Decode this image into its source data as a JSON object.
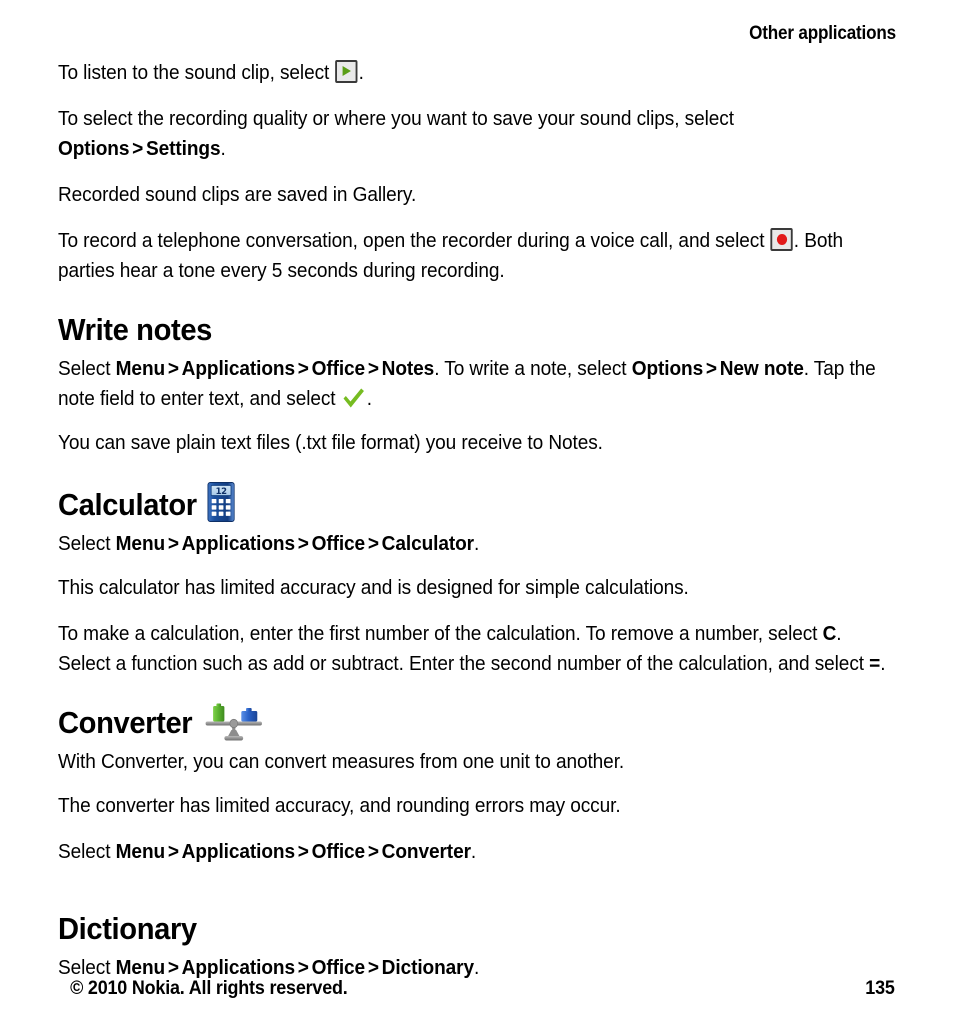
{
  "header": {
    "title": "Other applications"
  },
  "paragraphs": {
    "p1_a": "To listen to the sound clip, select ",
    "p1_b": ".",
    "p2_a": "To select the recording quality or where you want to save your sound clips, select ",
    "p2_options": "Options",
    "p2_gt": ">",
    "p2_settings": "Settings",
    "p2_b": ".",
    "p3": "Recorded sound clips are saved in Gallery.",
    "p4_a": "To record a telephone conversation, open the recorder during a voice call, and select ",
    "p4_b": ". Both parties hear a tone every 5 seconds during recording."
  },
  "sections": [
    {
      "id": "write-notes",
      "heading": "Write notes",
      "icon": null,
      "path": {
        "select": "Select ",
        "menu": "Menu",
        "gt": ">",
        "applications": "Applications",
        "office": "Office",
        "app": "Notes"
      },
      "after_path": ". To write a note, select ",
      "options": "Options",
      "new_note": "New note",
      "tail_a": ". Tap the note field to enter text, and select ",
      "tail_b": ".",
      "extra": "You can save plain text files (.txt file format) you receive to Notes."
    },
    {
      "id": "calculator",
      "heading": "Calculator",
      "icon": "calculator-icon",
      "icon_display": "12",
      "path": {
        "select": "Select ",
        "menu": "Menu",
        "gt": ">",
        "applications": "Applications",
        "office": "Office",
        "app": "Calculator"
      },
      "para1": "This calculator has limited accuracy and is designed for simple calculations.",
      "para2_a": "To make a calculation, enter the first number of the calculation. To remove a number, select ",
      "para2_c": "C",
      "para2_b": ". Select a function such as add or subtract. Enter the second number of the calculation, and select ",
      "para2_eq": "=",
      "para2_end": "."
    },
    {
      "id": "converter",
      "heading": "Converter",
      "icon": "balance-scale-icon",
      "para1": "With Converter, you can convert measures from one unit to another.",
      "para2": "The converter has limited accuracy, and rounding errors may occur.",
      "path": {
        "select": "Select ",
        "menu": "Menu",
        "gt": ">",
        "applications": "Applications",
        "office": "Office",
        "app": "Converter"
      }
    },
    {
      "id": "dictionary",
      "heading": "Dictionary",
      "icon": null,
      "path": {
        "select": "Select ",
        "menu": "Menu",
        "gt": ">",
        "applications": "Applications",
        "office": "Office",
        "app": "Dictionary"
      }
    }
  ],
  "footer": {
    "copyright": "© 2010 Nokia. All rights reserved.",
    "page_number": "135"
  },
  "colors": {
    "play_green": "#5a9e16",
    "record_red": "#e21b1b",
    "check_green": "#76bc21",
    "calculator_blue": "#1b4f9c",
    "converter_green": "#5cb430",
    "converter_blue": "#2a62c8",
    "scale_gray": "#8a8a8a",
    "text": "#000000",
    "background": "#ffffff"
  }
}
